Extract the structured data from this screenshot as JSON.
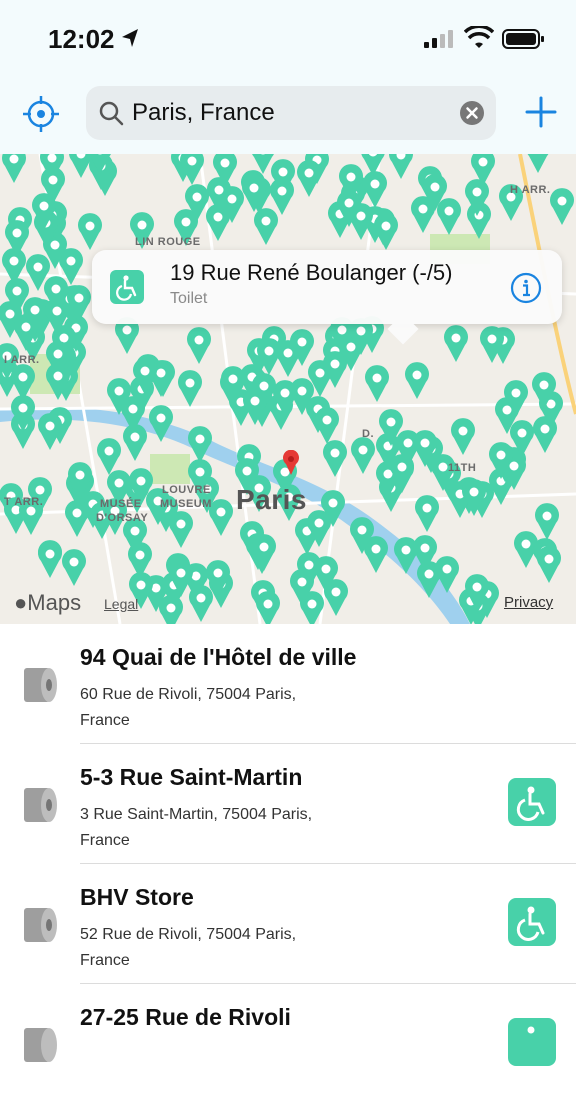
{
  "status_bar": {
    "time": "12:02"
  },
  "search": {
    "value": "Paris, France",
    "placeholder": ""
  },
  "map": {
    "labels": [
      "H ARR.",
      "LIN ROUGE",
      "I ARR.",
      "MUSÉE",
      "D'ORSAY",
      "LOUVRE",
      "MUSEUM",
      "Paris",
      "11TH",
      "T ARR.",
      "D."
    ],
    "attribution": "Maps",
    "legal": "Legal",
    "privacy": "Privacy",
    "pin_color": "#48d1a9"
  },
  "callout": {
    "title": "19 Rue René Boulanger (-/5)",
    "subtitle": "Toilet"
  },
  "list": [
    {
      "title": "94 Quai de l'Hôtel de ville",
      "address_line1": "60 Rue de Rivoli, 75004 Paris,",
      "address_line2": "France",
      "accessible": false
    },
    {
      "title": "5-3 Rue Saint-Martin",
      "address_line1": "3 Rue Saint-Martin, 75004 Paris,",
      "address_line2": "France",
      "accessible": true
    },
    {
      "title": "BHV Store",
      "address_line1": "52 Rue de Rivoli, 75004 Paris,",
      "address_line2": "France",
      "accessible": true
    },
    {
      "title": "27-25 Rue de Rivoli",
      "address_line1": "",
      "address_line2": "",
      "accessible": true
    }
  ],
  "colors": {
    "accent": "#1a84e0",
    "pin": "#48d1a9",
    "selected_pin": "#e53935"
  }
}
